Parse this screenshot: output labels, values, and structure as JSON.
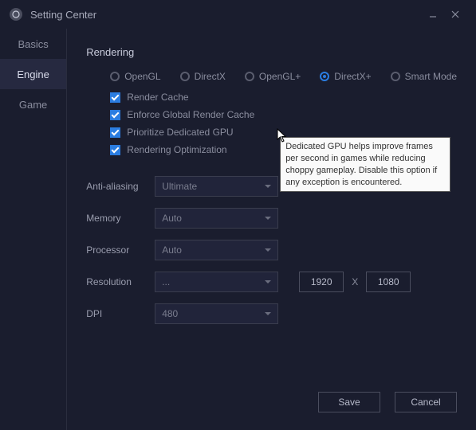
{
  "window": {
    "title": "Setting Center"
  },
  "sidebar": {
    "items": [
      {
        "label": "Basics"
      },
      {
        "label": "Engine"
      },
      {
        "label": "Game"
      }
    ]
  },
  "rendering": {
    "title": "Rendering",
    "modes": [
      {
        "label": "OpenGL"
      },
      {
        "label": "DirectX"
      },
      {
        "label": "OpenGL+"
      },
      {
        "label": "DirectX+"
      },
      {
        "label": "Smart Mode"
      }
    ],
    "checks": [
      {
        "label": "Render Cache"
      },
      {
        "label": "Enforce Global Render Cache"
      },
      {
        "label": "Prioritize Dedicated GPU"
      },
      {
        "label": "Rendering Optimization"
      }
    ]
  },
  "fields": {
    "aa": {
      "label": "Anti-aliasing",
      "value": "Ultimate"
    },
    "mem": {
      "label": "Memory",
      "value": "Auto"
    },
    "cpu": {
      "label": "Processor",
      "value": "Auto"
    },
    "res": {
      "label": "Resolution",
      "value": "...",
      "w": "1920",
      "x": "X",
      "h": "1080"
    },
    "dpi": {
      "label": "DPI",
      "value": "480"
    }
  },
  "tooltip": "Dedicated GPU helps improve frames per second in games while reducing choppy gameplay. Disable this option if any exception is encountered.",
  "footer": {
    "save": "Save",
    "cancel": "Cancel"
  }
}
